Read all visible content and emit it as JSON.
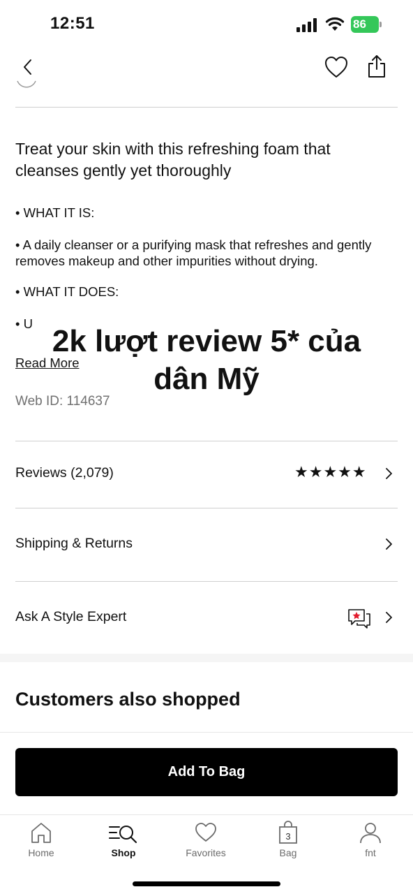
{
  "status_bar": {
    "time": "12:51",
    "battery": "86"
  },
  "description": {
    "title": "Treat your skin with this refreshing foam that cleanses gently yet thoroughly",
    "bullets": [
      "• WHAT IT IS:",
      "• A daily cleanser or a purifying mask that refreshes and gently removes makeup and other impurities without drying.",
      "• WHAT IT DOES:",
      "• U"
    ],
    "read_more": "Read More",
    "web_id": "Web ID: 114637"
  },
  "overlay": {
    "text": "2k lượt review 5* của dân Mỹ"
  },
  "rows": {
    "reviews": {
      "label": "Reviews (2,079)",
      "stars": "★★★★★",
      "rating": 5
    },
    "shipping": {
      "label": "Shipping & Returns"
    },
    "expert": {
      "label": "Ask A Style Expert"
    }
  },
  "customers_section": {
    "title": "Customers also shopped"
  },
  "add_to_bag": {
    "label": "Add To Bag"
  },
  "tabbar": {
    "items": [
      {
        "label": "Home",
        "icon": "home-icon"
      },
      {
        "label": "Shop",
        "icon": "search-list-icon",
        "active": true
      },
      {
        "label": "Favorites",
        "icon": "heart-icon"
      },
      {
        "label": "Bag",
        "icon": "bag-icon",
        "badge": "3"
      },
      {
        "label": "fnt",
        "icon": "person-icon"
      }
    ]
  },
  "colors": {
    "accent_star": "#e21a2c",
    "battery": "#34c759"
  }
}
